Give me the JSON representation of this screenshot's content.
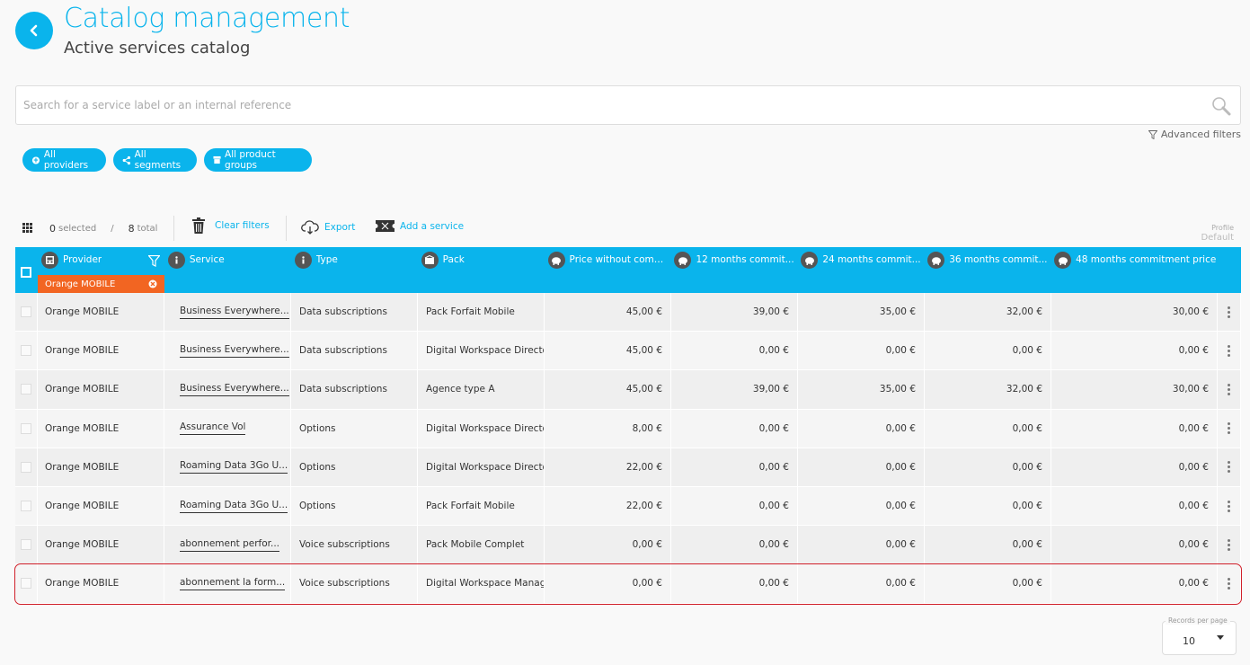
{
  "header": {
    "title": "Catalog management",
    "subtitle": "Active services catalog"
  },
  "search": {
    "placeholder": "Search for a service label or an internal reference"
  },
  "advanced_filters_label": "Advanced filters",
  "chips": [
    {
      "label": "All providers",
      "icon": "providers-icon"
    },
    {
      "label": "All segments",
      "icon": "share-icon"
    },
    {
      "label": "All product groups",
      "icon": "box-icon"
    }
  ],
  "toolbar": {
    "selected_count": "0",
    "selected_label": "selected",
    "separator": "/",
    "total_count": "8",
    "total_label": "total",
    "clear_filters": "Clear filters",
    "export": "Export",
    "add_service": "Add a service",
    "profile_label": "Profile",
    "profile_value": "Default"
  },
  "columns": [
    {
      "key": "provider",
      "label": "Provider",
      "icon": "provider-icon"
    },
    {
      "key": "service",
      "label": "Service",
      "icon": "info-icon"
    },
    {
      "key": "type",
      "label": "Type",
      "icon": "info-icon"
    },
    {
      "key": "pack",
      "label": "Pack",
      "icon": "pack-icon"
    },
    {
      "key": "price",
      "label": "Price without comm...",
      "icon": "piggy-bank-icon"
    },
    {
      "key": "m12",
      "label": "12 months commit...",
      "icon": "piggy-bank-icon"
    },
    {
      "key": "m24",
      "label": "24 months commit...",
      "icon": "piggy-bank-icon"
    },
    {
      "key": "m36",
      "label": "36 months commit...",
      "icon": "piggy-bank-icon"
    },
    {
      "key": "m48",
      "label": "48 months commitment price",
      "icon": "piggy-bank-icon"
    }
  ],
  "provider_filter": "Orange MOBILE",
  "rows": [
    {
      "provider": "Orange MOBILE",
      "service": "Business Everywhere...",
      "type": "Data subscriptions",
      "pack": "Pack Forfait Mobile",
      "price": "45,00 €",
      "m12": "39,00 €",
      "m24": "35,00 €",
      "m36": "32,00 €",
      "m48": "30,00 €"
    },
    {
      "provider": "Orange MOBILE",
      "service": "Business Everywhere...",
      "type": "Data subscriptions",
      "pack": "Digital Workspace Director",
      "price": "45,00 €",
      "m12": "0,00 €",
      "m24": "0,00 €",
      "m36": "0,00 €",
      "m48": "0,00 €"
    },
    {
      "provider": "Orange MOBILE",
      "service": "Business Everywhere...",
      "type": "Data subscriptions",
      "pack": "Agence type A",
      "price": "45,00 €",
      "m12": "39,00 €",
      "m24": "35,00 €",
      "m36": "32,00 €",
      "m48": "30,00 €"
    },
    {
      "provider": "Orange MOBILE",
      "service": "Assurance Vol",
      "type": "Options",
      "pack": "Digital Workspace Director",
      "price": "8,00 €",
      "m12": "0,00 €",
      "m24": "0,00 €",
      "m36": "0,00 €",
      "m48": "0,00 €"
    },
    {
      "provider": "Orange MOBILE",
      "service": "Roaming Data 3Go U...",
      "type": "Options",
      "pack": "Digital Workspace Director",
      "price": "22,00 €",
      "m12": "0,00 €",
      "m24": "0,00 €",
      "m36": "0,00 €",
      "m48": "0,00 €"
    },
    {
      "provider": "Orange MOBILE",
      "service": "Roaming Data 3Go U...",
      "type": "Options",
      "pack": "Pack Forfait Mobile",
      "price": "22,00 €",
      "m12": "0,00 €",
      "m24": "0,00 €",
      "m36": "0,00 €",
      "m48": "0,00 €"
    },
    {
      "provider": "Orange MOBILE",
      "service": "abonnement perfor...",
      "type": "Voice subscriptions",
      "pack": "Pack Mobile Complet",
      "price": "0,00 €",
      "m12": "0,00 €",
      "m24": "0,00 €",
      "m36": "0,00 €",
      "m48": "0,00 €"
    },
    {
      "provider": "Orange MOBILE",
      "service": "abonnement la form...",
      "type": "Voice subscriptions",
      "pack": "Digital Workspace Manager",
      "price": "0,00 €",
      "m12": "0,00 €",
      "m24": "0,00 €",
      "m36": "0,00 €",
      "m48": "0,00 €"
    }
  ],
  "records_per_page": {
    "label": "Records per page",
    "value": "10"
  },
  "colors": {
    "accent": "#0ab4ec",
    "filter_tag": "#f26522",
    "highlight": "#d0202a"
  }
}
